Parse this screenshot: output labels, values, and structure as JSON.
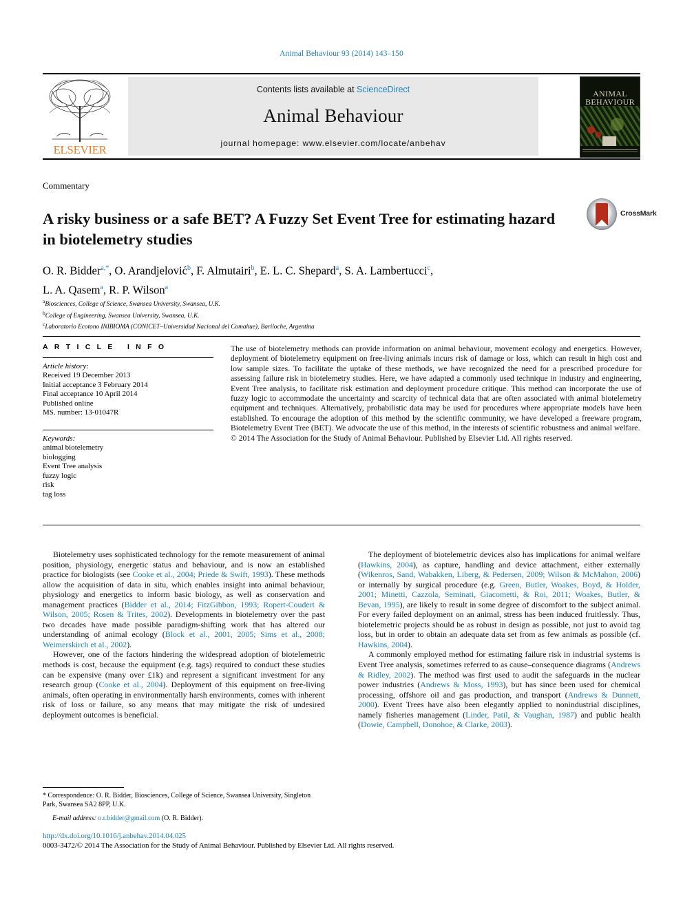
{
  "running_head": "Animal Behaviour 93 (2014) 143–150",
  "masthead": {
    "publisher_name": "ELSEVIER",
    "contents_prefix": "Contents lists available at ",
    "contents_link": "ScienceDirect",
    "journal_title": "Animal Behaviour",
    "homepage_line": "journal homepage: www.elsevier.com/locate/anbehav",
    "cover_title_line1": "ANIMAL",
    "cover_title_line2": "BEHAVIOUR"
  },
  "article": {
    "section_label": "Commentary",
    "title": "A risky business or a safe BET? A Fuzzy Set Event Tree for estimating hazard in biotelemetry studies",
    "crossmark_label": "CrossMark",
    "authors_line1_parts": [
      {
        "name": "O. R. Bidder",
        "marks": "a,*"
      },
      {
        "name": "O. Arandjelović",
        "marks": "b"
      },
      {
        "name": "F. Almutairi",
        "marks": "b"
      },
      {
        "name": "E. L. C. Shepard",
        "marks": "a"
      },
      {
        "name": "S. A. Lambertucci",
        "marks": "c"
      }
    ],
    "authors_line2_parts": [
      {
        "name": "L. A. Qasem",
        "marks": "a"
      },
      {
        "name": "R. P. Wilson",
        "marks": "a"
      }
    ],
    "affiliations": [
      {
        "mark": "a",
        "text": "Biosciences, College of Science, Swansea University, Swansea, U.K."
      },
      {
        "mark": "b",
        "text": "College of Engineering, Swansea University, Swansea, U.K."
      },
      {
        "mark": "c",
        "text": "Laboratorio Ecotono INIBIOMA (CONICET–Universidad Nacional del Comahue), Bariloche, Argentina"
      }
    ]
  },
  "info": {
    "heading": "ARTICLE INFO",
    "history_label": "Article history:",
    "history_lines": [
      "Received 19 December 2013",
      "Initial acceptance 3 February 2014",
      "Final acceptance 10 April 2014",
      "Published online",
      "MS. number: 13-01047R"
    ],
    "keywords_label": "Keywords:",
    "keywords": [
      "animal biotelemetry",
      "biologging",
      "Event Tree analysis",
      "fuzzy logic",
      "risk",
      "tag loss"
    ]
  },
  "abstract": {
    "text": "The use of biotelemetry methods can provide information on animal behaviour, movement ecology and energetics. However, deployment of biotelemetry equipment on free-living animals incurs risk of damage or loss, which can result in high cost and low sample sizes. To facilitate the uptake of these methods, we have recognized the need for a prescribed procedure for assessing failure risk in biotelemetry studies. Here, we have adapted a commonly used technique in industry and engineering, Event Tree analysis, to facilitate risk estimation and deployment procedure critique. This method can incorporate the use of fuzzy logic to accommodate the uncertainty and scarcity of technical data that are often associated with animal biotelemetry equipment and techniques. Alternatively, probabilistic data may be used for procedures where appropriate models have been established. To encourage the adoption of this method by the scientific community, we have developed a freeware program, Biotelemetry Event Tree (BET). We advocate the use of this method, in the interests of scientific robustness and animal welfare.",
    "copyright": "© 2014 The Association for the Study of Animal Behaviour. Published by Elsevier Ltd. All rights reserved."
  },
  "body": {
    "left_paragraphs": [
      {
        "segments": [
          {
            "t": "Biotelemetry uses sophisticated technology for the remote measurement of animal position, physiology, energetic status and behaviour, and is now an established practice for biologists (see ",
            "cite": false
          },
          {
            "t": "Cooke et al., 2004; Priede & Swift, 1993",
            "cite": true
          },
          {
            "t": "). These methods allow the acquisition of data in situ, which enables insight into animal behaviour, physiology and energetics to inform basic biology, as well as conservation and management practices (",
            "cite": false
          },
          {
            "t": "Bidder et al., 2014; FitzGibbon, 1993; Ropert-Coudert & Wilson, 2005; Rosen & Trites, 2002",
            "cite": true
          },
          {
            "t": "). Developments in biotelemetry over the past two decades have made possible paradigm-shifting work that has altered our understanding of animal ecology (",
            "cite": false
          },
          {
            "t": "Block et al., 2001, 2005; Sims et al., 2008; Weimerskirch et al., 2002",
            "cite": true
          },
          {
            "t": ").",
            "cite": false
          }
        ]
      },
      {
        "segments": [
          {
            "t": "However, one of the factors hindering the widespread adoption of biotelemetric methods is cost, because the equipment (e.g. tags) required to conduct these studies can be expensive (many over £1k) and represent a significant investment for any research group (",
            "cite": false
          },
          {
            "t": "Cooke et al., 2004",
            "cite": true
          },
          {
            "t": "). Deployment of this equipment on free-living animals, often operating in environmentally harsh environments, comes with inherent risk of loss or failure, so any means that may mitigate the risk of undesired deployment outcomes is beneficial.",
            "cite": false
          }
        ]
      }
    ],
    "right_paragraphs": [
      {
        "segments": [
          {
            "t": "The deployment of biotelemetric devices also has implications for animal welfare (",
            "cite": false
          },
          {
            "t": "Hawkins, 2004",
            "cite": true
          },
          {
            "t": "), as capture, handling and device attachment, either externally (",
            "cite": false
          },
          {
            "t": "Wikenros, Sand, Wabakken, Liberg, & Pedersen, 2009; Wilson & McMahon, 2006",
            "cite": true
          },
          {
            "t": ") or internally by surgical procedure (e.g. ",
            "cite": false
          },
          {
            "t": "Green, Butler, Woakes, Boyd, & Holder, 2001; Minetti, Cazzola, Seminati, Giacometti, & Roi, 2011; Woakes, Butler, & Bevan, 1995",
            "cite": true
          },
          {
            "t": "), are likely to result in some degree of discomfort to the subject animal. For every failed deployment on an animal, stress has been induced fruitlessly. Thus, biotelemetric projects should be as robust in design as possible, not just to avoid tag loss, but in order to obtain an adequate data set from as few animals as possible (cf. ",
            "cite": false
          },
          {
            "t": "Hawkins, 2004",
            "cite": true
          },
          {
            "t": ").",
            "cite": false
          }
        ]
      },
      {
        "segments": [
          {
            "t": "A commonly employed method for estimating failure risk in industrial systems is Event Tree analysis, sometimes referred to as cause–consequence diagrams (",
            "cite": false
          },
          {
            "t": "Andrews & Ridley, 2002",
            "cite": true
          },
          {
            "t": "). The method was first used to audit the safeguards in the nuclear power industries (",
            "cite": false
          },
          {
            "t": "Andrews & Moss, 1993",
            "cite": true
          },
          {
            "t": "), but has since been used for chemical processing, offshore oil and gas production, and transport (",
            "cite": false
          },
          {
            "t": "Andrews & Dunnett, 2000",
            "cite": true
          },
          {
            "t": "). Event Trees have also been elegantly applied to nonindustrial disciplines, namely fisheries management (",
            "cite": false
          },
          {
            "t": "Linder, Patil, & Vaughan, 1987",
            "cite": true
          },
          {
            "t": ") and public health (",
            "cite": false
          },
          {
            "t": "Dowie, Campbell, Donohoe, & Clarke, 2003",
            "cite": true
          },
          {
            "t": ").",
            "cite": false
          }
        ]
      }
    ]
  },
  "footnote": {
    "correspondence": "* Correspondence: O. R. Bidder, Biosciences, College of Science, Swansea University, Singleton Park, Swansea SA2 8PP, U.K.",
    "email_label": "E-mail address:",
    "email": "o.r.bidder@gmail.com",
    "email_owner": "(O. R. Bidder)."
  },
  "bottom": {
    "doi": "http://dx.doi.org/10.1016/j.anbehav.2014.04.025",
    "issn_line": "0003-3472/© 2014 The Association for the Study of Animal Behaviour. Published by Elsevier Ltd. All rights reserved."
  },
  "colors": {
    "link": "#1a7fb5",
    "elsevier_orange": "#f07e26",
    "band_gray": "#e8e8e8"
  }
}
